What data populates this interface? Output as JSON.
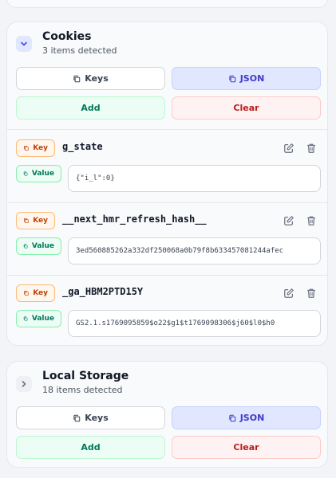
{
  "cookies": {
    "title": "Cookies",
    "subtitle": "3 items detected",
    "keys_label": "Keys",
    "json_label": "JSON",
    "add_label": "Add",
    "clear_label": "Clear",
    "items": [
      {
        "key_badge": "Key",
        "value_badge": "Value",
        "name": "g_state",
        "value": "{\"i_l\":0}"
      },
      {
        "key_badge": "Key",
        "value_badge": "Value",
        "name": "__next_hmr_refresh_hash__",
        "value": "3ed560885262a332df250068a0b79f8b633457081244afec"
      },
      {
        "key_badge": "Key",
        "value_badge": "Value",
        "name": "_ga_HBM2PTD15Y",
        "value": "GS2.1.s1769095859$o22$g1$t1769098306$j60$l0$h0"
      }
    ]
  },
  "local_storage": {
    "title": "Local Storage",
    "subtitle": "18 items detected",
    "keys_label": "Keys",
    "json_label": "JSON",
    "add_label": "Add",
    "clear_label": "Clear"
  },
  "colors": {
    "accent": "#4338ca",
    "add_green": "#047857",
    "clear_red": "#b91c1c",
    "key_orange": "#c2410c"
  }
}
